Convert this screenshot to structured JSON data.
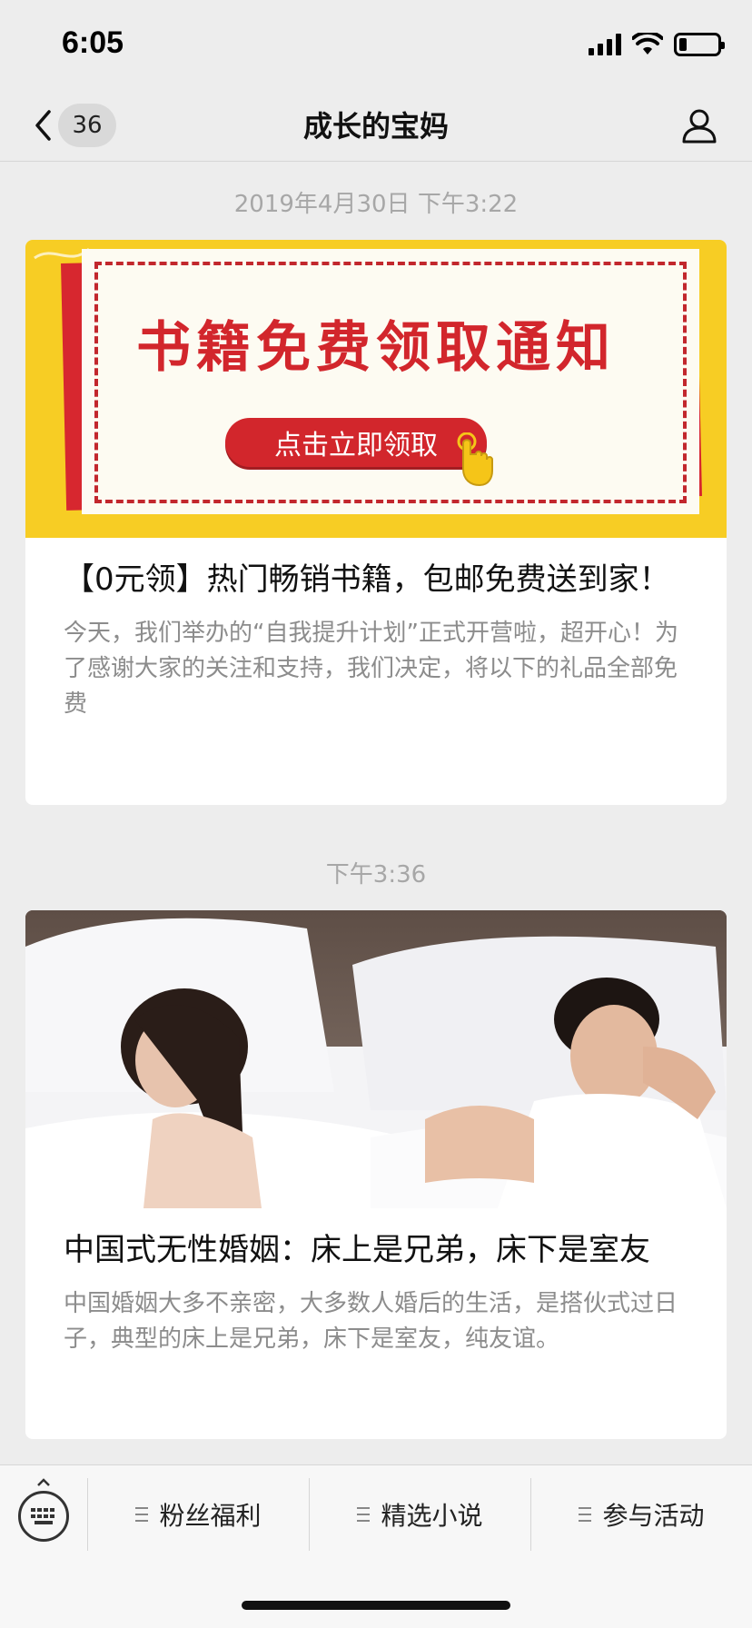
{
  "status_bar": {
    "time": "6:05",
    "icons": [
      "signal-icon",
      "wifi-icon",
      "battery-icon"
    ],
    "battery_percent": 20
  },
  "nav": {
    "back_icon": "chevron-left-icon",
    "unread_count": "36",
    "title": "成长的宝妈",
    "profile_icon": "person-icon"
  },
  "feed": [
    {
      "timestamp": "2019年4月30日 下午3:22",
      "cover": {
        "headline": "书籍免费领取通知",
        "cta": "点击立即领取",
        "colors": {
          "background": "#f7cd24",
          "accent": "#d2262c"
        }
      },
      "title": "【0元领】热门畅销书籍，包邮免费送到家！",
      "description": "今天，我们举办的“自我提升计划”正式开营啦，超开心！为了感谢大家的关注和支持，我们决定，将以下的礼品全部免费"
    },
    {
      "timestamp": "下午3:36",
      "cover": {},
      "title": "中国式无性婚姻：床上是兄弟，床下是室友",
      "description": "中国婚姻大多不亲密，大多数人婚后的生活，是搭伙式过日子，典型的床上是兄弟，床下是室友，纯友谊。"
    }
  ],
  "bottom_menu": {
    "keyboard_icon": "keyboard-icon",
    "items": [
      {
        "label": "粉丝福利",
        "icon": "menu-icon"
      },
      {
        "label": "精选小说",
        "icon": "menu-icon"
      },
      {
        "label": "参与活动",
        "icon": "menu-icon"
      }
    ]
  }
}
